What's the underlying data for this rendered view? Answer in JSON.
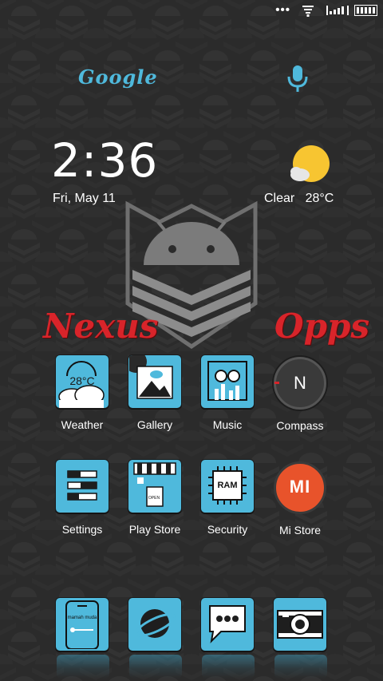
{
  "status_bar": {
    "dots": "•••",
    "icons": [
      "wifi-icon",
      "signal-icon",
      "battery-icon"
    ]
  },
  "search": {
    "logo_text": "Google",
    "mic_icon": "mic-icon"
  },
  "clock": {
    "time": "2:36",
    "date": "Fri, May 11"
  },
  "weather": {
    "condition": "Clear",
    "temp": "28°C",
    "icon": "sun-cloud-icon"
  },
  "titles": {
    "left": "Nexus",
    "right": "Opps"
  },
  "apps_row1": [
    {
      "label": "Weather",
      "icon": "weather-icon",
      "inner_text": "28°C"
    },
    {
      "label": "Gallery",
      "icon": "gallery-icon"
    },
    {
      "label": "Music",
      "icon": "music-icon"
    },
    {
      "label": "Compass",
      "icon": "compass-icon",
      "inner_text": "N"
    }
  ],
  "apps_row2": [
    {
      "label": "Settings",
      "icon": "settings-icon"
    },
    {
      "label": "Play Store",
      "icon": "store-icon",
      "inner_text": "OPEN"
    },
    {
      "label": "Security",
      "icon": "chip-icon",
      "inner_text": "RAM"
    },
    {
      "label": "Mi Store",
      "icon": "mi-icon",
      "inner_text": "MI"
    }
  ],
  "dock": [
    {
      "name": "phone",
      "icon": "phone-icon",
      "inner_text": "mamah muda"
    },
    {
      "name": "browser",
      "icon": "planet-icon"
    },
    {
      "name": "messages",
      "icon": "chat-icon"
    },
    {
      "name": "camera",
      "icon": "camera-icon"
    }
  ],
  "colors": {
    "accent": "#4fb9dc",
    "title_red": "#d8242a",
    "background": "#2a2a2a",
    "sun": "#f7c531",
    "mi_orange": "#e8532b"
  }
}
